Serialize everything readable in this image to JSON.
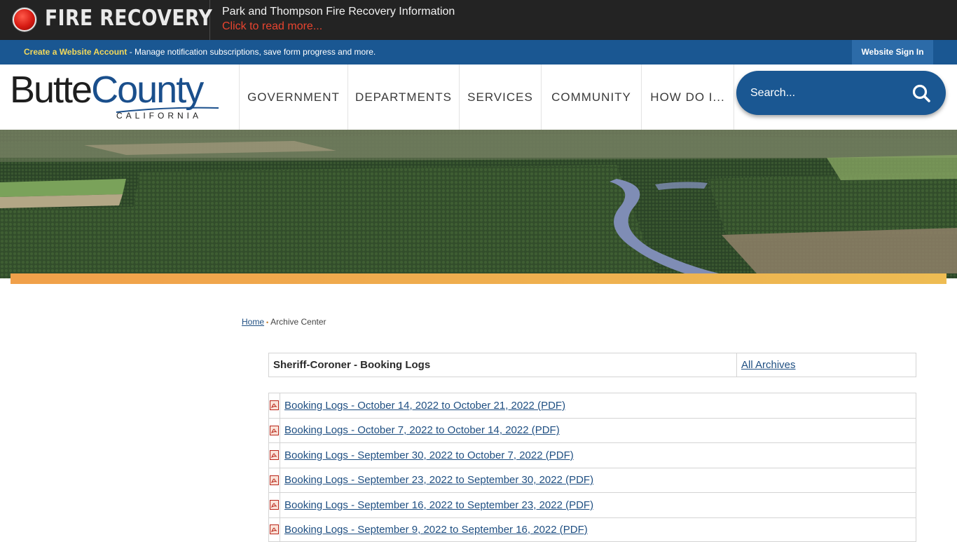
{
  "alert": {
    "title": "FIRE RECOVERY",
    "heading": "Park and Thompson Fire Recovery Information",
    "link": "Click to read more..."
  },
  "account": {
    "create_link": "Create a Website Account",
    "message": " - Manage notification subscriptions, save form progress and more.",
    "signin": "Website Sign In"
  },
  "logo": {
    "butte": "Butte",
    "county": "County",
    "state": "CALIFORNIA"
  },
  "nav": {
    "items": [
      "GOVERNMENT",
      "DEPARTMENTS",
      "SERVICES",
      "COMMUNITY",
      "HOW DO I..."
    ]
  },
  "search": {
    "placeholder": "Search..."
  },
  "breadcrumb": {
    "home": "Home",
    "current": "Archive Center"
  },
  "archive": {
    "title": "Sheriff-Coroner - Booking Logs",
    "all_link": "All Archives",
    "documents": [
      "Booking Logs - October 14, 2022 to October 21, 2022 (PDF)",
      "Booking Logs - October 7, 2022 to October 14, 2022 (PDF)",
      "Booking Logs - September 30, 2022 to October 7, 2022 (PDF)",
      "Booking Logs - September 23, 2022 to September 30, 2022 (PDF)",
      "Booking Logs - September 16, 2022 to September 23, 2022 (PDF)",
      "Booking Logs - September 9, 2022 to September 16, 2022 (PDF)"
    ]
  },
  "colors": {
    "alert_bg": "#232323",
    "alert_link": "#e8442f",
    "brand_blue": "#1a5792",
    "account_link": "#f3d95b",
    "accent_orange": "#f0a04a",
    "link_blue": "#1f4f82"
  },
  "icons": {
    "alert": "red-alert-dot-icon",
    "search": "search-icon",
    "document": "pdf-icon"
  }
}
